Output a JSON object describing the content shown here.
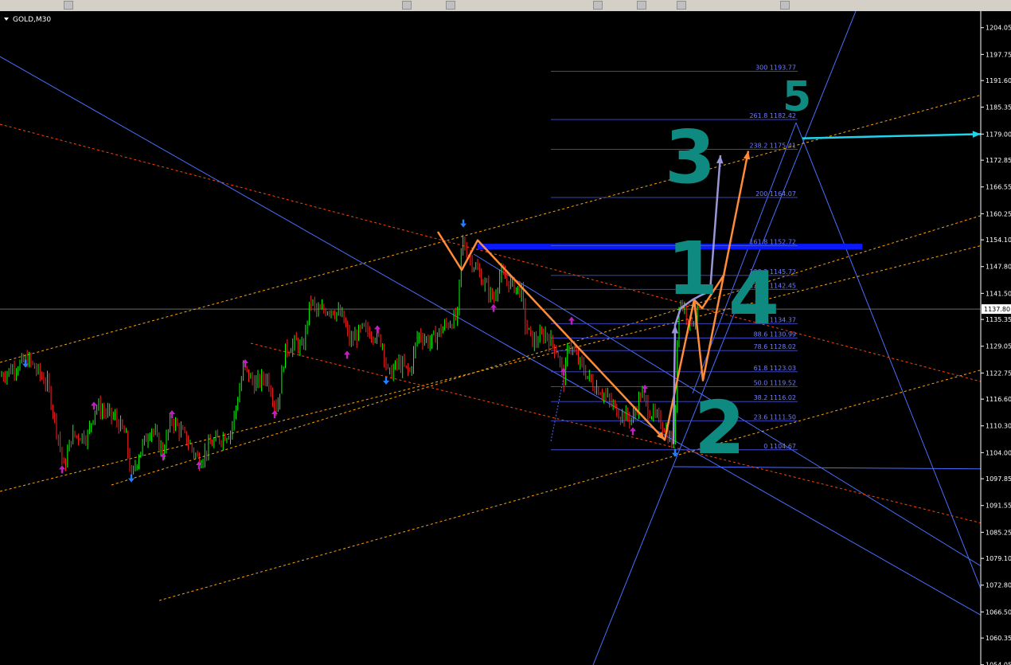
{
  "window": {
    "symbol_label": "GOLD,M30"
  },
  "colors": {
    "background": "#000000",
    "bull_candle": "#00ff00",
    "bear_candle": "#ff2020",
    "fib_line": "#3f4fd6",
    "fib_text": "#6f7cff",
    "trend_blue": "#4a6fff",
    "channel_orange": "#ffa500",
    "channel_red": "#ff4500",
    "wave_orange": "#ff8c3a",
    "wave_purple": "#9a96d8",
    "resistance": "#0a1aff",
    "target_arrow": "#22d3ee",
    "wave_label": "#0f8a80",
    "arrow_up": "#c020c0",
    "arrow_down": "#2080ff"
  },
  "chart_data": {
    "type": "candlestick",
    "symbol": "GOLD",
    "timeframe": "M30",
    "ylim": [
      1054.0,
      1207.0
    ],
    "y_ticks": [
      "1204.05",
      "1197.75",
      "1191.60",
      "1185.35",
      "1179.00",
      "1172.85",
      "1166.55",
      "1160.25",
      "1154.10",
      "1147.80",
      "1141.50",
      "1135.35",
      "1129.05",
      "1122.75",
      "1116.60",
      "1110.30",
      "1104.00",
      "1097.85",
      "1091.55",
      "1085.25",
      "1079.10",
      "1072.80",
      "1066.50",
      "1060.35",
      "1054.05"
    ],
    "current_price": "1137.80",
    "current_price_value": 1137.8,
    "price_path": [
      [
        0,
        1122
      ],
      [
        35,
        1126
      ],
      [
        60,
        1120
      ],
      [
        75,
        1106
      ],
      [
        80,
        1100
      ],
      [
        90,
        1108
      ],
      [
        110,
        1108
      ],
      [
        120,
        1115
      ],
      [
        145,
        1112
      ],
      [
        158,
        1108
      ],
      [
        165,
        1098
      ],
      [
        175,
        1104
      ],
      [
        190,
        1110
      ],
      [
        205,
        1104
      ],
      [
        215,
        1112
      ],
      [
        235,
        1107
      ],
      [
        250,
        1102
      ],
      [
        265,
        1106
      ],
      [
        290,
        1109
      ],
      [
        300,
        1118
      ],
      [
        306,
        1124
      ],
      [
        320,
        1120
      ],
      [
        335,
        1122
      ],
      [
        348,
        1114
      ],
      [
        358,
        1128
      ],
      [
        372,
        1130
      ],
      [
        380,
        1128
      ],
      [
        390,
        1140
      ],
      [
        398,
        1137
      ],
      [
        415,
        1138
      ],
      [
        430,
        1136
      ],
      [
        440,
        1130
      ],
      [
        455,
        1133
      ],
      [
        470,
        1132
      ],
      [
        480,
        1130
      ],
      [
        488,
        1122
      ],
      [
        500,
        1125
      ],
      [
        515,
        1123
      ],
      [
        525,
        1132
      ],
      [
        540,
        1130
      ],
      [
        560,
        1134
      ],
      [
        575,
        1136
      ],
      [
        580,
        1154
      ],
      [
        590,
        1150
      ],
      [
        605,
        1145
      ],
      [
        620,
        1140
      ],
      [
        628,
        1146
      ],
      [
        640,
        1144
      ],
      [
        655,
        1142
      ],
      [
        660,
        1134
      ],
      [
        670,
        1130
      ],
      [
        685,
        1132
      ],
      [
        700,
        1128
      ],
      [
        708,
        1121
      ],
      [
        715,
        1130
      ],
      [
        725,
        1126
      ],
      [
        745,
        1120
      ],
      [
        758,
        1118
      ],
      [
        765,
        1116
      ],
      [
        780,
        1113
      ],
      [
        795,
        1112
      ],
      [
        805,
        1118
      ],
      [
        815,
        1114
      ],
      [
        835,
        1110
      ],
      [
        847,
        1105
      ],
      [
        852,
        1140
      ],
      [
        860,
        1138
      ],
      [
        866,
        1134
      ],
      [
        872,
        1136
      ]
    ],
    "fib_levels": [
      {
        "ratio": "0",
        "price": "1104.67",
        "value": 1104.67
      },
      {
        "ratio": "23.6",
        "price": "1111.50",
        "value": 1111.5
      },
      {
        "ratio": "38.2",
        "price": "1116.02",
        "value": 1116.02
      },
      {
        "ratio": "50.0",
        "price": "1119.52",
        "value": 1119.52
      },
      {
        "ratio": "61.8",
        "price": "1123.03",
        "value": 1123.03
      },
      {
        "ratio": "78.6",
        "price": "1128.02",
        "value": 1128.02
      },
      {
        "ratio": "88.6",
        "price": "1130.99",
        "value": 1130.99
      },
      {
        "ratio": "100",
        "price": "1134.37",
        "value": 1134.37
      },
      {
        "ratio": "127.2",
        "price": "1142.45",
        "value": 1142.45
      },
      {
        "ratio": "138.2",
        "price": "1145.72",
        "value": 1145.72
      },
      {
        "ratio": "161.8",
        "price": "1152.72",
        "value": 1152.72
      },
      {
        "ratio": "200",
        "price": "1164.07",
        "value": 1164.07
      },
      {
        "ratio": "238.2",
        "price": "1175.41",
        "value": 1175.41
      },
      {
        "ratio": "261.8",
        "price": "1182.42",
        "value": 1182.42
      },
      {
        "ratio": "300",
        "price": "1193.77",
        "value": 1193.77
      }
    ],
    "resistance_level": 1152.5,
    "wave_labels": [
      "1",
      "2",
      "3",
      "4",
      "5"
    ],
    "fractals_up": [
      [
        32,
        1124
      ],
      [
        582,
        1157
      ],
      [
        485,
        1120
      ],
      [
        165,
        1097
      ],
      [
        848,
        1103
      ]
    ],
    "fractals_down": [
      [
        78,
        1101
      ],
      [
        118,
        1116
      ],
      [
        205,
        1104
      ],
      [
        216,
        1114
      ],
      [
        250,
        1102
      ],
      [
        308,
        1126
      ],
      [
        345,
        1114
      ],
      [
        436,
        1128
      ],
      [
        474,
        1134
      ],
      [
        620,
        1139
      ],
      [
        708,
        1124
      ],
      [
        718,
        1136
      ],
      [
        795,
        1110
      ],
      [
        810,
        1120
      ]
    ],
    "elliott_wave_orange": [
      [
        550,
        1156
      ],
      [
        580,
        1147
      ],
      [
        600,
        1154
      ],
      [
        835,
        1107
      ],
      [
        872,
        1140
      ],
      [
        883,
        1121
      ],
      [
        940,
        1175
      ]
    ],
    "elliott_wave_purple": [
      [
        846,
        1106
      ],
      [
        848,
        1134
      ],
      [
        855,
        1138
      ],
      [
        870,
        1140
      ],
      [
        880,
        1141
      ],
      [
        892,
        1142
      ],
      [
        905,
        1174
      ]
    ],
    "target_arrow": {
      "from": [
        1008,
        1178
      ],
      "to": [
        1232,
        1179
      ]
    }
  }
}
